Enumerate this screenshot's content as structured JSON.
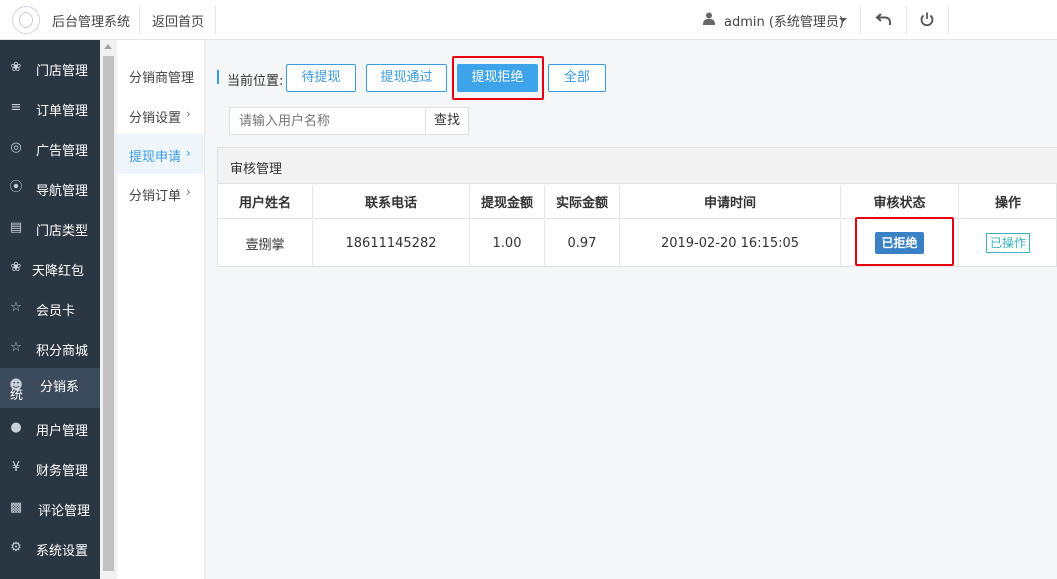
{
  "header": {
    "title": "后台管理系统",
    "home_link": "返回首页",
    "user": "admin (系统管理员)"
  },
  "sidebar": {
    "items": [
      {
        "label": "门店管理",
        "icon": "store-icon"
      },
      {
        "label": "订单管理",
        "icon": "list-icon"
      },
      {
        "label": "广告管理",
        "icon": "lifebuoy-icon"
      },
      {
        "label": "导航管理",
        "icon": "compass-icon"
      },
      {
        "label": "门店类型",
        "icon": "bank-icon"
      },
      {
        "label": "天降红包",
        "icon": "gift-icon"
      },
      {
        "label": "会员卡",
        "icon": "star-icon"
      },
      {
        "label": "积分商城",
        "icon": "star-icon"
      },
      {
        "label": "分销系",
        "label2": "统",
        "icon": "users-icon"
      },
      {
        "label": "用户管理",
        "icon": "user-icon"
      },
      {
        "label": "财务管理",
        "icon": "yen-icon"
      },
      {
        "label": "评论管理",
        "icon": "money-icon"
      },
      {
        "label": "系统设置",
        "icon": "gear-icon"
      }
    ]
  },
  "submenu": {
    "items": [
      {
        "label": "分销商管理",
        "arrow": ""
      },
      {
        "label": "分销设置",
        "arrow": "›"
      },
      {
        "label": "提现申请",
        "arrow": "›"
      },
      {
        "label": "分销订单",
        "arrow": "›"
      }
    ]
  },
  "breadcrumb": {
    "label": "当前位置:"
  },
  "filters": {
    "pending": "待提现",
    "approved": "提现通过",
    "rejected": "提现拒绝",
    "all": "全部"
  },
  "search": {
    "placeholder": "请输入用户名称",
    "button": "查找"
  },
  "panel": {
    "title": "审核管理"
  },
  "table": {
    "headers": [
      "用户姓名",
      "联系电话",
      "提现金额",
      "实际金额",
      "申请时间",
      "审核状态",
      "操作"
    ],
    "rows": [
      {
        "name": "壹捌掌",
        "phone": "18611145282",
        "amount": "1.00",
        "actual": "0.97",
        "time": "2019-02-20 16:15:05",
        "status": "已拒绝",
        "action": "已操作"
      }
    ]
  },
  "colors": {
    "accent": "#3a9be0",
    "sidebar_bg": "#2b3643",
    "highlight": "#e60012"
  }
}
